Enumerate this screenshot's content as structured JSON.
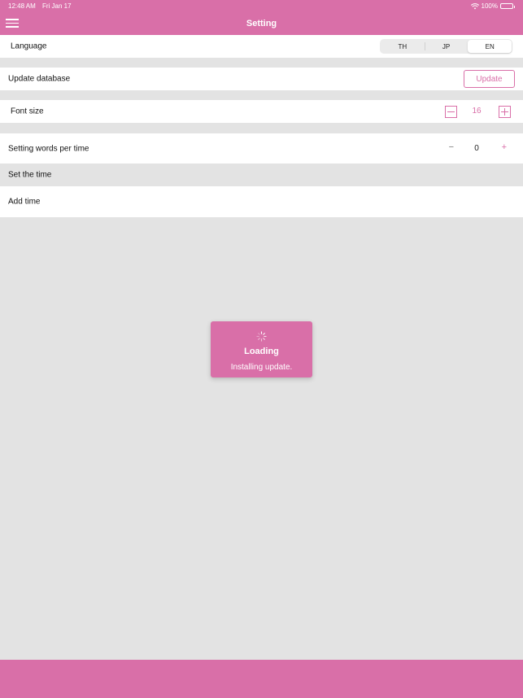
{
  "status_bar": {
    "time": "12:48 AM",
    "date": "Fri Jan 17",
    "battery": "100%"
  },
  "nav": {
    "title": "Setting",
    "menu_icon": "hamburger-menu-icon"
  },
  "language": {
    "label": "Language",
    "options": [
      "TH",
      "JP",
      "EN"
    ],
    "selected": "EN"
  },
  "update_database": {
    "label": "Update database",
    "button": "Update"
  },
  "font_size": {
    "label": "Font size",
    "value": "16",
    "minus_icon": "minus-icon",
    "plus_icon": "plus-icon"
  },
  "words_per_time": {
    "label": "Setting words per time",
    "value": "0",
    "minus": "−",
    "plus": "+"
  },
  "set_the_time": {
    "label": "Set the time"
  },
  "add_time": {
    "label": "Add time"
  },
  "loading_toast": {
    "title": "Loading",
    "message": "Installing update.",
    "icon": "spinner-icon"
  },
  "colors": {
    "accent": "#d96fa8",
    "background": "#e3e3e3",
    "row": "#ffffff"
  }
}
